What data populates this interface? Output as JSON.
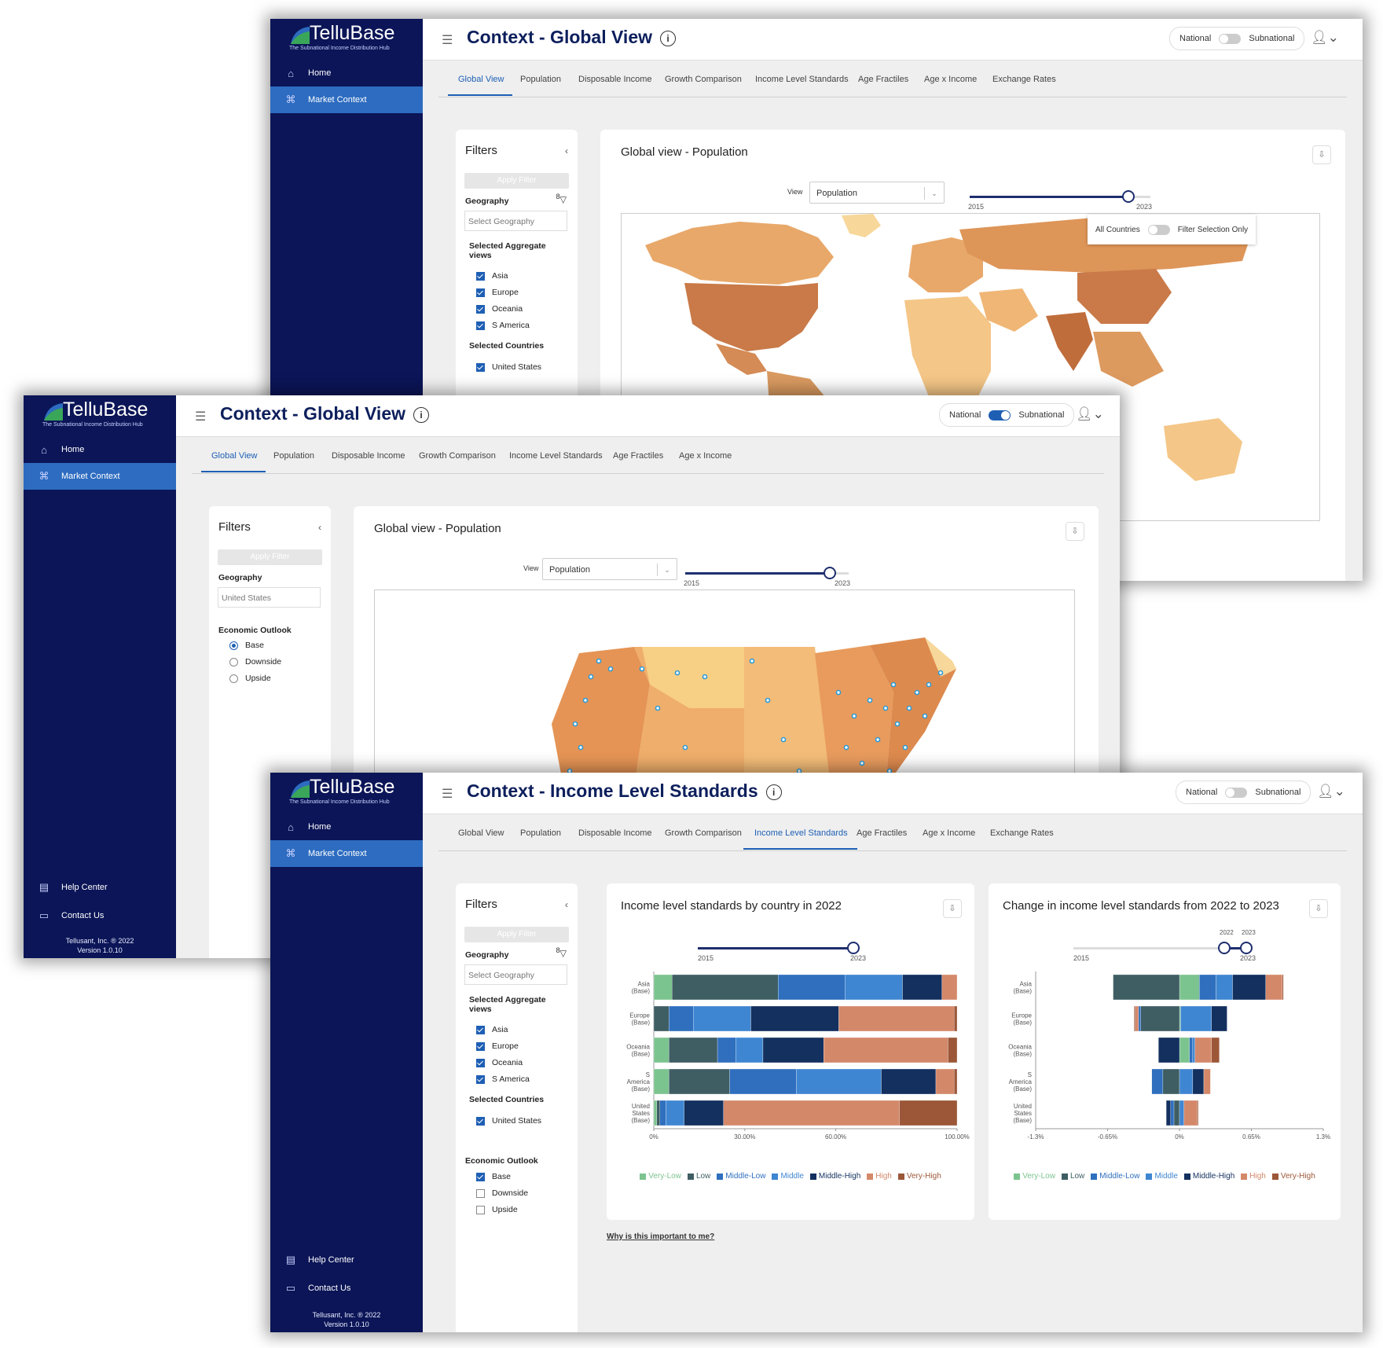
{
  "app": {
    "brand": "TelluBase",
    "tagline": "The Subnational Income Distribution Hub",
    "nav": [
      "Home",
      "Market Context"
    ],
    "help": "Help Center",
    "contact": "Contact Us",
    "footer_company": "Tellusant, Inc. ® 2022",
    "footer_version": "Version 1.0.10",
    "colors": {
      "sidebar": "#0b1557",
      "accent": "#1e5fb4",
      "title": "#0d1f5c"
    }
  },
  "toggle": {
    "left": "National",
    "right": "Subnational"
  },
  "tabs": [
    "Global View",
    "Population",
    "Disposable Income",
    "Growth Comparison",
    "Income Level Standards",
    "Age Fractiles",
    "Age x Income",
    "Exchange Rates"
  ],
  "filters": {
    "heading": "Filters",
    "apply": "Apply Filter",
    "geography_label": "Geography",
    "geography_placeholder": "Select Geography",
    "geography_value": "United States",
    "funnel_badge": "8",
    "aggregate_label_1": "Selected Aggregate",
    "aggregate_label_2": "views",
    "aggregates": [
      "Asia",
      "Europe",
      "Oceania",
      "S America"
    ],
    "countries_label": "Selected Countries",
    "countries": [
      "United States"
    ],
    "outlook_label": "Economic Outlook",
    "outlook_options": [
      "Base",
      "Downside",
      "Upside"
    ]
  },
  "window1": {
    "title": "Context - Global View",
    "toggle_on": false,
    "card_title": "Global view - Population",
    "view_label": "View",
    "view_value": "Population",
    "year_start": "2015",
    "year_end": "2023",
    "map_toggle_left": "All Countries",
    "map_toggle_right": "Filter Selection Only"
  },
  "window2": {
    "title": "Context - Global View",
    "toggle_on": true,
    "card_title": "Global view - Population",
    "view_label": "View",
    "view_value": "Population",
    "year_start": "2015",
    "year_end": "2023"
  },
  "window3": {
    "title": "Context - Income Level Standards",
    "toggle_on": false,
    "chart1_title": "Income level standards by country in 2022",
    "chart2_title": "Change in income level standards from 2022 to 2023",
    "year_start": "2015",
    "year_end": "2023",
    "range_lo": "2022",
    "range_hi": "2023",
    "why_link": "Why is this important to me?"
  },
  "chart_data": [
    {
      "type": "bar",
      "orientation": "horizontal-stacked-100",
      "title": "Income level standards by country in 2022",
      "categories": [
        "Asia (Base)",
        "Europe (Base)",
        "Oceania (Base)",
        "S America (Base)",
        "United States (Base)"
      ],
      "xticks": [
        "0%",
        "30.00%",
        "60.00%",
        "100.00%"
      ],
      "xlim": [
        0,
        100
      ],
      "series": [
        {
          "name": "Very-Low",
          "color": "#7cc48f",
          "values": [
            6,
            0,
            5,
            5,
            1
          ]
        },
        {
          "name": "Low",
          "color": "#3f5e63",
          "values": [
            35,
            5,
            16,
            20,
            1
          ]
        },
        {
          "name": "Middle-Low",
          "color": "#2f6fbe",
          "values": [
            22,
            8,
            6,
            22,
            2
          ]
        },
        {
          "name": "Middle",
          "color": "#3f86d2",
          "values": [
            19,
            19,
            9,
            28,
            6
          ]
        },
        {
          "name": "Middle-High",
          "color": "#13305f",
          "values": [
            13,
            29,
            20,
            18,
            13
          ]
        },
        {
          "name": "High",
          "color": "#d4886a",
          "values": [
            5,
            38,
            41,
            6,
            58
          ]
        },
        {
          "name": "Very-High",
          "color": "#9c5738",
          "values": [
            0,
            1,
            3,
            1,
            19
          ]
        }
      ],
      "legend": "bottom"
    },
    {
      "type": "bar",
      "orientation": "horizontal-stacked-diverging",
      "title": "Change in income level standards from 2022 to 2023",
      "categories": [
        "Asia (Base)",
        "Europe (Base)",
        "Oceania (Base)",
        "S America (Base)",
        "United States (Base)"
      ],
      "xticks": [
        "-1.3%",
        "-0.65%",
        "0%",
        "0.65%",
        "1.3%"
      ],
      "xlim": [
        -1.3,
        1.3
      ],
      "series": [
        {
          "name": "Very-Low",
          "color": "#7cc48f",
          "values": [
            0.18,
            0.01,
            0.09,
            0.0,
            0.0
          ]
        },
        {
          "name": "Low",
          "color": "#3f5e63",
          "values": [
            -0.6,
            -0.35,
            0.0,
            -0.15,
            -0.05
          ]
        },
        {
          "name": "Middle-Low",
          "color": "#2f6fbe",
          "values": [
            0.15,
            -0.02,
            0.03,
            -0.1,
            -0.03
          ]
        },
        {
          "name": "Middle",
          "color": "#3f86d2",
          "values": [
            0.15,
            0.28,
            0.02,
            0.12,
            0.04
          ]
        },
        {
          "name": "Middle-High",
          "color": "#13305f",
          "values": [
            0.3,
            0.14,
            -0.19,
            0.1,
            -0.04
          ]
        },
        {
          "name": "High",
          "color": "#d4886a",
          "values": [
            0.15,
            -0.03,
            0.15,
            0.06,
            0.12
          ]
        },
        {
          "name": "Very-High",
          "color": "#9c5738",
          "values": [
            0.01,
            -0.01,
            0.07,
            0.0,
            0.01
          ]
        }
      ],
      "legend": "bottom"
    }
  ]
}
